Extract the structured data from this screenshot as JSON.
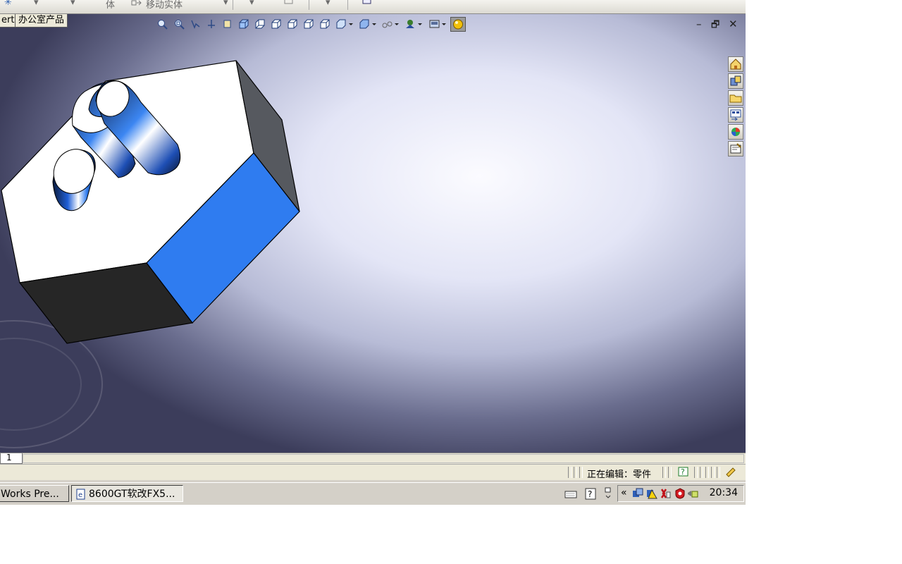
{
  "command_bar": {
    "items": [
      "✳",
      "▾",
      "▾",
      "体",
      "移动实体",
      "▾",
      "▾",
      "▾"
    ]
  },
  "viewport": {
    "tabs": [
      "ert",
      "办公室产品"
    ],
    "heads_up_icons": [
      "zoom-to-fit-icon",
      "zoom-to-area-icon",
      "previous-view-icon",
      "section-view-icon",
      "view-orientation-icon",
      "front-view-icon",
      "back-view-icon",
      "left-view-icon",
      "right-view-icon",
      "top-view-icon",
      "isometric-view-icon",
      "display-style-icon",
      "hide-show-icon",
      "edit-appearance-icon",
      "apply-scene-icon",
      "realview-icon"
    ],
    "window_controls": {
      "minimize": "–",
      "restore": "🗗",
      "close": "✕"
    },
    "task_pane_icons": [
      "home-icon",
      "design-library-icon",
      "file-explorer-icon",
      "view-palette-icon",
      "appearances-icon",
      "custom-properties-icon"
    ],
    "model_colors": {
      "top": "#ffffff",
      "blue": "#2f7cf0",
      "dark": "#262626",
      "gray": "#56595f"
    }
  },
  "sheet_tab": {
    "label": "1"
  },
  "status_bar": {
    "editing": "正在编辑：零件",
    "help_icon": "help-icon",
    "rebuild_icon": "rebuild-icon"
  },
  "taskbar": {
    "buttons": [
      "Works Pre...",
      "8600GT软改FX5..."
    ],
    "clock": "20:34",
    "tray_icons": [
      "keyboard-icon",
      "help-icon",
      "network-icon",
      "collapse-icon",
      "monitor-icon",
      "warning-icon",
      "antivirus-icon",
      "shield-icon",
      "speaker-icon"
    ]
  }
}
